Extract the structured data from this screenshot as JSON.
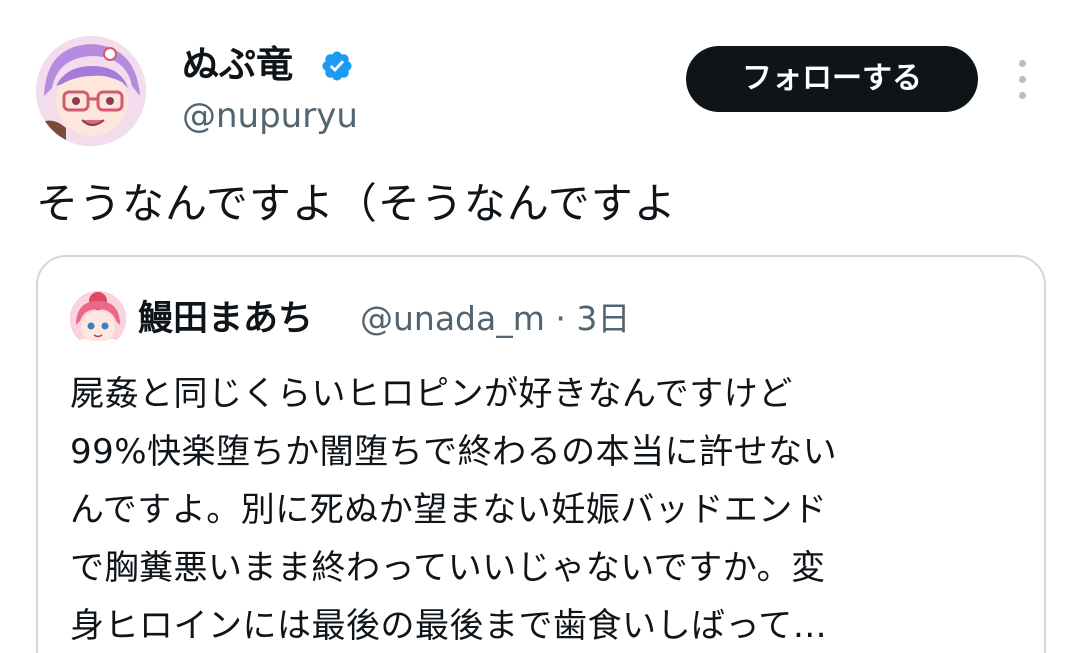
{
  "tweet": {
    "author": {
      "display_name": "ぬぷ竜",
      "handle": "@nupuryu",
      "verified": true,
      "avatar_icon": "anime-avatar"
    },
    "follow_label": "フォローする",
    "more_icon": "more-vertical-icon",
    "text": "そうなんですよ（そうなんですよ"
  },
  "quote": {
    "author": {
      "display_name": "鰻田まあち",
      "handle": "@unada_m",
      "separator": "·",
      "time": "3日",
      "avatar_icon": "anime-avatar"
    },
    "lines": [
      "屍姦と同じくらいヒロピンが好きなんですけど",
      "99%快楽堕ちか闇堕ちで終わるの本当に許せない",
      "んですよ。別に死ぬか望まない妊娠バッドエンド",
      "で胸糞悪いまま終わっていいじゃないですか。変",
      "身ヒロインには最後の最後まで歯食いしばって…"
    ]
  },
  "colors": {
    "text_primary": "#0f1419",
    "text_secondary": "#536471",
    "verified_blue": "#1d9bf0",
    "button_bg": "#0f1419",
    "border": "#cfd9de"
  }
}
